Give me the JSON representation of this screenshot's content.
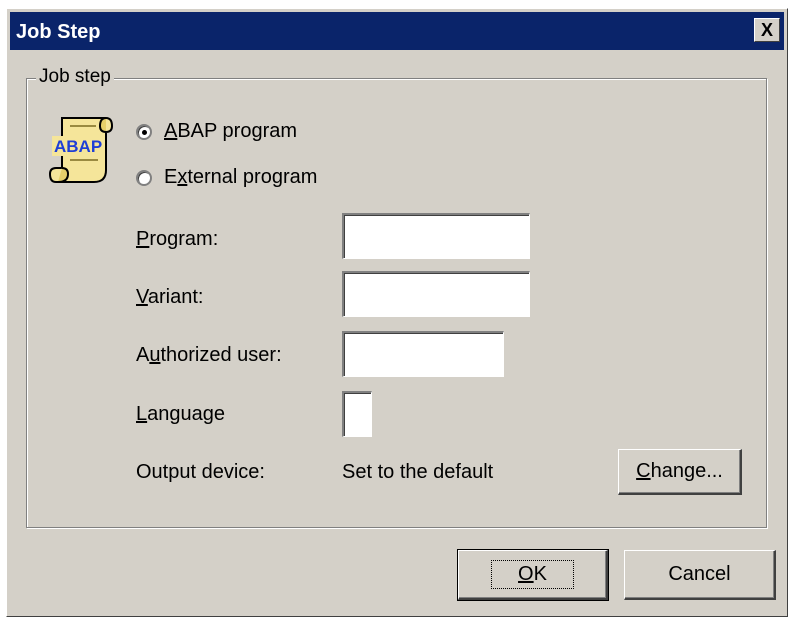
{
  "window": {
    "title": "Job Step",
    "close_label": "X"
  },
  "group": {
    "label": "Job step"
  },
  "icon": {
    "name": "abap-script-icon",
    "text": "ABAP"
  },
  "radio": {
    "abap": {
      "before": "",
      "accel": "A",
      "after": "BAP program",
      "checked": true
    },
    "external": {
      "before": "E",
      "accel": "x",
      "after": "ternal program",
      "checked": false
    }
  },
  "fields": {
    "program": {
      "accel": "P",
      "rest": "rogram:",
      "value": ""
    },
    "variant": {
      "accel": "V",
      "rest": "ariant:",
      "value": ""
    },
    "authorized_user": {
      "before": "A",
      "accel": "u",
      "rest": "thorized user:",
      "value": ""
    },
    "language": {
      "accel": "L",
      "rest": "anguage",
      "value": ""
    },
    "output_device": {
      "label": "Output device:",
      "value": "Set to the default"
    }
  },
  "buttons": {
    "change": {
      "accel": "C",
      "rest": "hange..."
    },
    "ok": {
      "accel": "O",
      "rest": "K"
    },
    "cancel": {
      "label": "Cancel"
    }
  }
}
